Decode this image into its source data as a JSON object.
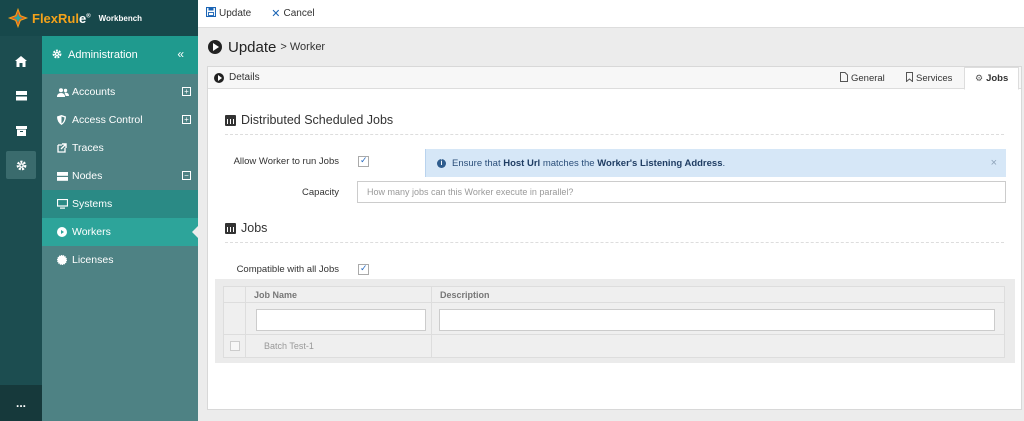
{
  "brand": {
    "name_orange": "FlexRul",
    "name_white": "e",
    "sub": "Workbench",
    "reg": "®"
  },
  "rail": {
    "items": [
      "home-icon",
      "server-icon",
      "archive-icon",
      "gear-icon"
    ],
    "bottom": "..."
  },
  "sidebar": {
    "header": "Administration",
    "collapse": "«",
    "items": [
      {
        "label": "Accounts",
        "icon": "users-icon",
        "expander": "+"
      },
      {
        "label": "Access Control",
        "icon": "shield-icon",
        "expander": "+"
      },
      {
        "label": "Traces",
        "icon": "external-link-icon"
      },
      {
        "label": "Nodes",
        "icon": "server-icon",
        "expander": "−"
      },
      {
        "label": "Systems",
        "icon": "monitor-icon"
      },
      {
        "label": "Workers",
        "icon": "play-icon"
      },
      {
        "label": "Licenses",
        "icon": "certificate-icon"
      }
    ]
  },
  "toolbar": {
    "update": "Update",
    "cancel": "Cancel"
  },
  "title": {
    "main": "Update",
    "sub": "> Worker"
  },
  "panel": {
    "details": "Details",
    "tabs": [
      "General",
      "Services",
      "Jobs"
    ],
    "active_tab": "Jobs"
  },
  "distributed": {
    "title": "Distributed Scheduled Jobs",
    "allow_label": "Allow Worker to run Jobs",
    "allow_checked": true,
    "capacity_label": "Capacity",
    "capacity_placeholder": "How many jobs can this Worker execute in parallel?",
    "alert": {
      "p1": "Ensure that ",
      "b1": "Host Url",
      "p2": " matches the ",
      "b2": "Worker's Listening Address",
      "p3": ".",
      "close": "×"
    }
  },
  "jobs": {
    "title": "Jobs",
    "compatible_label": "Compatible with all Jobs",
    "compatible_checked": true,
    "columns": [
      "Job Name",
      "Description"
    ],
    "rows": [
      {
        "name": "Batch Test-1",
        "description": ""
      }
    ]
  }
}
